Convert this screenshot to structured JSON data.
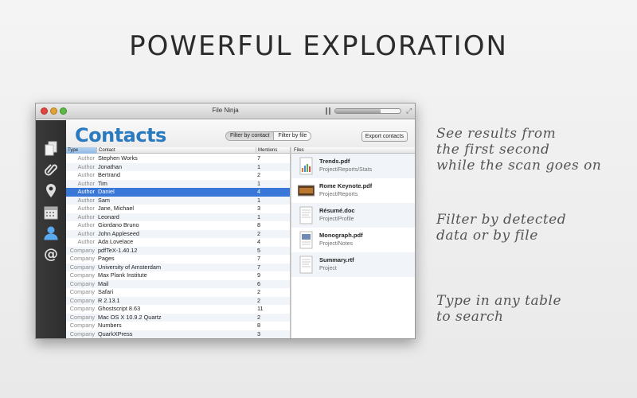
{
  "headline": "POWERFUL EXPLORATION",
  "window": {
    "title": "File Ninja",
    "scan_progress": 0.7
  },
  "sidebar": {
    "items": [
      {
        "icon": "documents-icon"
      },
      {
        "icon": "paperclip-icon"
      },
      {
        "icon": "location-pin-icon"
      },
      {
        "icon": "calendar-icon"
      },
      {
        "icon": "contact-person-icon",
        "active": true
      },
      {
        "icon": "at-sign-icon"
      }
    ]
  },
  "header": {
    "title": "Contacts",
    "filter_by_contact": "Filter by contact",
    "filter_by_file": "Filter by file",
    "export": "Export contacts"
  },
  "table": {
    "columns": [
      "Type",
      "Contact",
      "Mentions"
    ],
    "rows": [
      {
        "type": "Author",
        "contact": "Stephen Works",
        "mentions": "7"
      },
      {
        "type": "Author",
        "contact": "Jonathan",
        "mentions": "1"
      },
      {
        "type": "Author",
        "contact": "Bertrand",
        "mentions": "2"
      },
      {
        "type": "Author",
        "contact": "Tim",
        "mentions": "1"
      },
      {
        "type": "Author",
        "contact": "Daniel",
        "mentions": "4",
        "selected": true
      },
      {
        "type": "Author",
        "contact": "Sam",
        "mentions": "1"
      },
      {
        "type": "Author",
        "contact": "Jane, Michael",
        "mentions": "3"
      },
      {
        "type": "Author",
        "contact": "Leonard",
        "mentions": "1"
      },
      {
        "type": "Author",
        "contact": "Giordano Bruno",
        "mentions": "8"
      },
      {
        "type": "Author",
        "contact": "John Appleseed",
        "mentions": "2"
      },
      {
        "type": "Author",
        "contact": "Ada Lovelace",
        "mentions": "4"
      },
      {
        "type": "Company",
        "contact": "pdfTeX-1.40.12",
        "mentions": "5"
      },
      {
        "type": "Company",
        "contact": "Pages",
        "mentions": "7"
      },
      {
        "type": "Company",
        "contact": "University of Amsterdam",
        "mentions": "7"
      },
      {
        "type": "Company",
        "contact": "Max Plank Institute",
        "mentions": "9"
      },
      {
        "type": "Company",
        "contact": "Mail",
        "mentions": "6"
      },
      {
        "type": "Company",
        "contact": "Safari",
        "mentions": "2"
      },
      {
        "type": "Company",
        "contact": "R 2.13.1",
        "mentions": "2"
      },
      {
        "type": "Company",
        "contact": "Ghostscript 8.63",
        "mentions": "11"
      },
      {
        "type": "Company",
        "contact": "Mac OS X 10.9.2 Quartz",
        "mentions": "2"
      },
      {
        "type": "Company",
        "contact": "Numbers",
        "mentions": "8"
      },
      {
        "type": "Company",
        "contact": "QuarkXPress",
        "mentions": "3"
      }
    ]
  },
  "files": {
    "header": "Files",
    "items": [
      {
        "name": "Trends.pdf",
        "path": "Project/Reports/Stats",
        "thumb": "chart-thumb"
      },
      {
        "name": "Rome Keynote.pdf",
        "path": "Project/Reports",
        "thumb": "photo-thumb"
      },
      {
        "name": "Résumé.doc",
        "path": "Project/Profile",
        "thumb": "doc-thumb"
      },
      {
        "name": "Monograph.pdf",
        "path": "Project/Notes",
        "thumb": "pdf-thumb"
      },
      {
        "name": "Summary.rtf",
        "path": "Project",
        "thumb": "rtf-thumb"
      }
    ]
  },
  "notes": [
    {
      "lines": [
        "See results from",
        "the first second",
        "while the scan goes on"
      ]
    },
    {
      "lines": [
        "Filter by detected",
        "data or by file"
      ]
    },
    {
      "lines": [
        "Type in any table",
        "to search"
      ]
    }
  ],
  "colors": {
    "accent": "#2a7ac0",
    "selection": "#3877d8",
    "sidebar": "#333333"
  }
}
